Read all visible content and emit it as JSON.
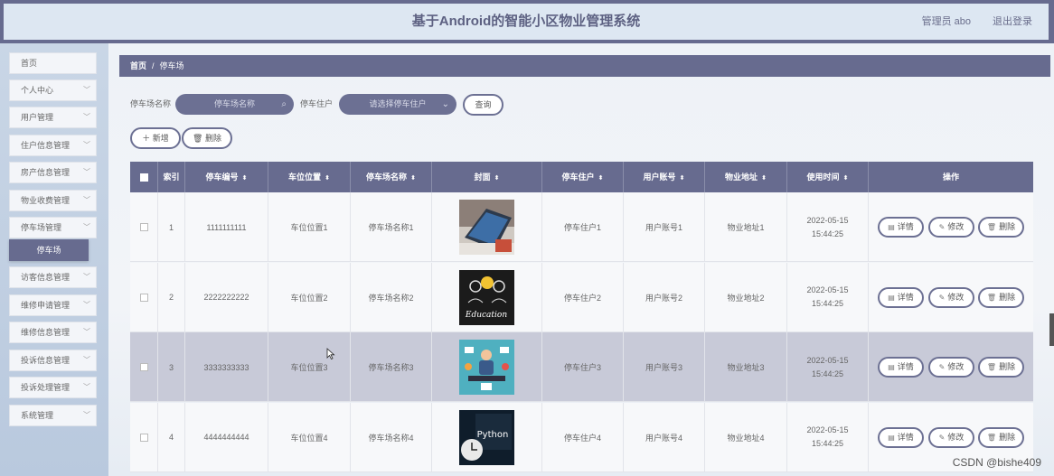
{
  "header": {
    "title": "基于Android的智能小区物业管理系统",
    "user": "管理员 abo",
    "logout": "退出登录"
  },
  "sidebar": {
    "items": [
      {
        "label": "首页",
        "chevron": false
      },
      {
        "label": "个人中心",
        "chevron": true
      },
      {
        "label": "用户管理",
        "chevron": true
      },
      {
        "label": "住户信息管理",
        "chevron": true
      },
      {
        "label": "房产信息管理",
        "chevron": true
      },
      {
        "label": "物业收费管理",
        "chevron": true
      },
      {
        "label": "停车场管理",
        "chevron": true
      },
      {
        "label": "访客信息管理",
        "chevron": true
      },
      {
        "label": "维修申请管理",
        "chevron": true
      },
      {
        "label": "维修信息管理",
        "chevron": true
      },
      {
        "label": "投诉信息管理",
        "chevron": true
      },
      {
        "label": "投诉处理管理",
        "chevron": true
      },
      {
        "label": "系统管理",
        "chevron": true
      }
    ],
    "active_sub": "停车场"
  },
  "breadcrumb": {
    "home": "首页",
    "sep": "/",
    "current": "停车场"
  },
  "search": {
    "name_label": "停车场名称",
    "name_placeholder": "停车场名称",
    "owner_label": "停车住户",
    "owner_placeholder": "请选择停车住户",
    "query_button": "查询"
  },
  "toolbar": {
    "add": "新增",
    "delete": "删除"
  },
  "table": {
    "columns": [
      "索引",
      "停车编号",
      "车位位置",
      "停车场名称",
      "封面",
      "停车住户",
      "用户账号",
      "物业地址",
      "使用时间",
      "操作"
    ],
    "rows": [
      {
        "index": "1",
        "code": "1111111111",
        "position": "车位位置1",
        "name": "停车场名称1",
        "cover": "laptop",
        "owner": "停车住户1",
        "account": "用户账号1",
        "address": "物业地址1",
        "time": "2022-05-15 15:44:25"
      },
      {
        "index": "2",
        "code": "2222222222",
        "position": "车位位置2",
        "name": "停车场名称2",
        "cover": "education",
        "owner": "停车住户2",
        "account": "用户账号2",
        "address": "物业地址2",
        "time": "2022-05-15 15:44:25"
      },
      {
        "index": "3",
        "code": "3333333333",
        "position": "车位位置3",
        "name": "停车场名称3",
        "cover": "multitask",
        "owner": "停车住户3",
        "account": "用户账号3",
        "address": "物业地址3",
        "time": "2022-05-15 15:44:25"
      },
      {
        "index": "4",
        "code": "4444444444",
        "position": "车位位置4",
        "name": "停车场名称4",
        "cover": "python",
        "owner": "停车住户4",
        "account": "用户账号4",
        "address": "物业地址4",
        "time": "2022-05-15 15:44:25"
      }
    ],
    "actions": {
      "detail": "详情",
      "edit": "修改",
      "delete": "删除"
    },
    "cover_texts": {
      "education": "Education",
      "python": "Python"
    }
  },
  "watermark": "CSDN @bishe409",
  "colors": {
    "accent": "#676b8f",
    "highlight_row": "#c8cad8"
  }
}
